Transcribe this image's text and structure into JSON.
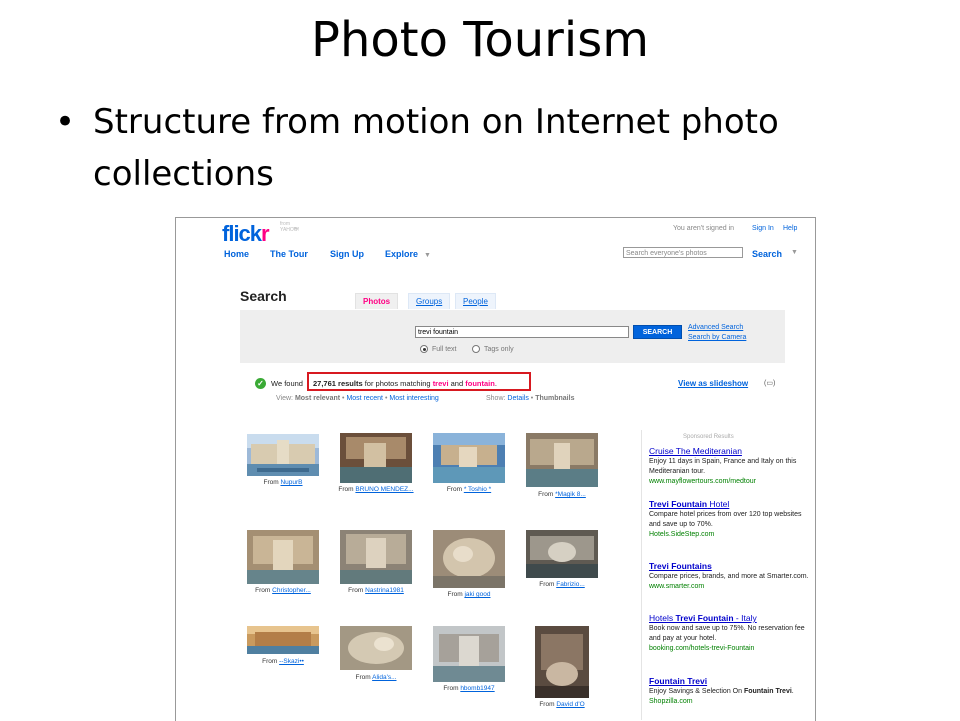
{
  "slide": {
    "title": "Photo Tourism",
    "bullet": "Structure from motion on Internet photo collections"
  },
  "flickr": {
    "logo": {
      "blue": "flick",
      "pink": "r",
      "tm": "™",
      "from": "from YAHOO!"
    },
    "nav": [
      {
        "label": "Home"
      },
      {
        "label": "The Tour"
      },
      {
        "label": "Sign Up"
      },
      {
        "label": "Explore",
        "caret": "▼"
      }
    ],
    "top_right": {
      "not_signed_in": "You aren't signed in",
      "sign_in": "Sign In",
      "help": "Help",
      "search_placeholder": "Search everyone's photos",
      "search_label": "Search",
      "caret": "▼"
    },
    "search_page": {
      "heading": "Search",
      "tabs": {
        "photos": "Photos",
        "groups": "Groups",
        "people": "People"
      },
      "query": "trevi fountain",
      "search_button": "SEARCH",
      "advanced_search": "Advanced Search",
      "search_by_camera": "Search by Camera",
      "full_text": "Full text",
      "tags_only": "Tags only"
    },
    "results": {
      "prefix": "We found",
      "count": "27,761 results",
      "mid": "for photos matching",
      "term1": "trevi",
      "and": "and",
      "term2": "fountain",
      "period": ".",
      "slideshow": "View as slideshow",
      "slideshow_paren": "(▭)",
      "view_label": "View:",
      "most_relevant": "Most relevant",
      "bullet": "•",
      "most_recent": "Most recent",
      "most_interesting": "Most interesting",
      "show_label": "Show:",
      "details": "Details",
      "thumbnails": "Thumbnails"
    },
    "photos": [
      {
        "from": "From",
        "user": "NupurB"
      },
      {
        "from": "From",
        "user": "BRUNO MENDEZ..."
      },
      {
        "from": "From",
        "user": "* Toshio *"
      },
      {
        "from": "From",
        "user": "*Magik 8..."
      },
      {
        "from": "From",
        "user": "Christopher..."
      },
      {
        "from": "From",
        "user": "Nastrina1981"
      },
      {
        "from": "From",
        "user": "jaki good"
      },
      {
        "from": "From",
        "user": "Fabrizio..."
      },
      {
        "from": "From",
        "user": "--Skazi••"
      },
      {
        "from": "From",
        "user": "Alida's..."
      },
      {
        "from": "From",
        "user": "hbomb1947"
      },
      {
        "from": "From",
        "user": "David d'O"
      }
    ],
    "sponsored": {
      "heading": "Sponsored Results",
      "ads": [
        {
          "title": "Cruise The Mediteranian",
          "body": "Enjoy 11 days in Spain, France and Italy on this Mediteranian tour.",
          "url": "www.mayflowertours.com/medtour"
        },
        {
          "title_bold": "Trevi Fountain",
          "title_rest": " Hotel",
          "body": "Compare hotel prices from over 120 top websites and save up to 70%.",
          "url": "Hotels.SideStep.com"
        },
        {
          "title_bold": "Trevi Fountains",
          "title_rest": "",
          "body": "Compare prices, brands, and more at Smarter.com.",
          "url": "www.smarter.com"
        },
        {
          "title_pre": "Hotels ",
          "title_bold": "Trevi Fountain",
          "title_rest": " - Italy",
          "body": "Book now and save up to 75%. No reservation fee and pay at your hotel.",
          "url": "booking.com/hotels-trevi-Fountain"
        },
        {
          "title_bold": "Fountain Trevi",
          "title_rest": "",
          "body_pre": "Enjoy Savings & Selection On ",
          "body_bold": "Fountain Trevi",
          "body_post": ".",
          "url": "Shopzilla.com"
        }
      ]
    }
  }
}
